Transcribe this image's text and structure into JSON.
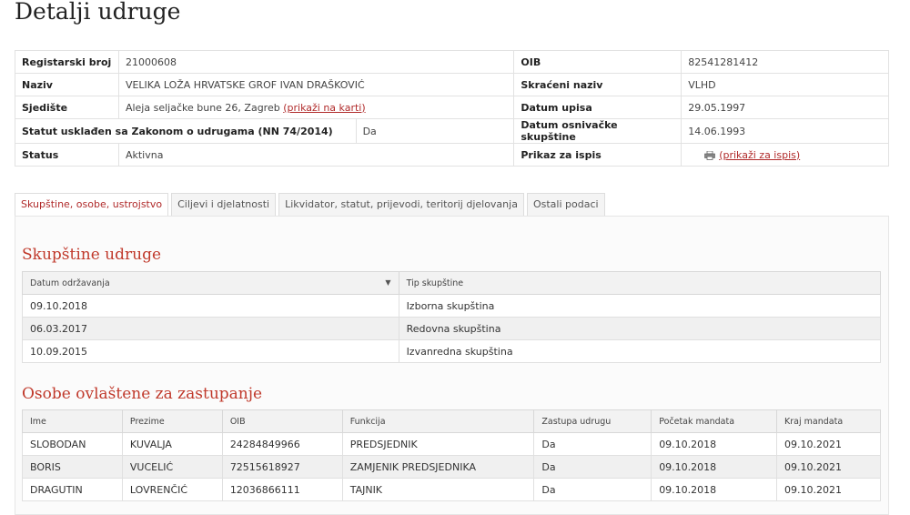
{
  "page": {
    "title": "Detalji udruge"
  },
  "details": {
    "rows": [
      {
        "left_label": "Registarski broj",
        "left_value": "21000608",
        "right_label": "OIB",
        "right_value": "82541281412"
      },
      {
        "left_label": "Naziv",
        "left_value": "VELIKA LOŽA HRVATSKE GROF IVAN DRAŠKOVIĆ",
        "right_label": "Skraćeni naziv",
        "right_value": "VLHD"
      },
      {
        "left_label": "Sjedište",
        "left_value": "Aleja seljačke bune 26, Zagreb",
        "left_link": "(prikaži na karti)",
        "right_label": "Datum upisa",
        "right_value": "29.05.1997"
      },
      {
        "left_label": "Statut usklađen sa Zakonom o udrugama (NN 74/2014)",
        "left_value": "Da",
        "right_label": "Datum osnivačke skupštine",
        "right_value": "14.06.1993"
      },
      {
        "left_label": "Status",
        "left_value": "Aktivna",
        "right_label": "Prikaz za ispis",
        "right_link": "(prikaži za ispis)"
      }
    ]
  },
  "tabs": [
    {
      "label": "Skupštine, osobe, ustrojstvo",
      "active": true
    },
    {
      "label": "Ciljevi i djelatnosti"
    },
    {
      "label": "Likvidator, statut, prijevodi, teritorij djelovanja"
    },
    {
      "label": "Ostali podaci"
    }
  ],
  "assemblies": {
    "title": "Skupštine udruge",
    "headers": [
      "Datum održavanja",
      "Tip skupštine"
    ],
    "rows": [
      [
        "09.10.2018",
        "Izborna skupština"
      ],
      [
        "06.03.2017",
        "Redovna skupština"
      ],
      [
        "10.09.2015",
        "Izvanredna skupština"
      ]
    ]
  },
  "persons": {
    "title": "Osobe ovlaštene za zastupanje",
    "headers": [
      "Ime",
      "Prezime",
      "OIB",
      "Funkcija",
      "Zastupa udrugu",
      "Početak mandata",
      "Kraj mandata"
    ],
    "rows": [
      [
        "SLOBODAN",
        "KUVALJA",
        "24284849966",
        "PREDSJEDNIK",
        "Da",
        "09.10.2018",
        "09.10.2021"
      ],
      [
        "BORIS",
        "VUCELIĆ",
        "72515618927",
        "ZAMJENIK PREDSJEDNIKA",
        "Da",
        "09.10.2018",
        "09.10.2021"
      ],
      [
        "DRAGUTIN",
        "LOVRENČIĆ",
        "12036866111",
        "TAJNIK",
        "Da",
        "09.10.2018",
        "09.10.2021"
      ]
    ]
  },
  "colors": {
    "accent": "#c0392b",
    "link": "#b02a2a"
  },
  "icons": {
    "print": "printer-icon",
    "sort": "sort-down-icon"
  }
}
